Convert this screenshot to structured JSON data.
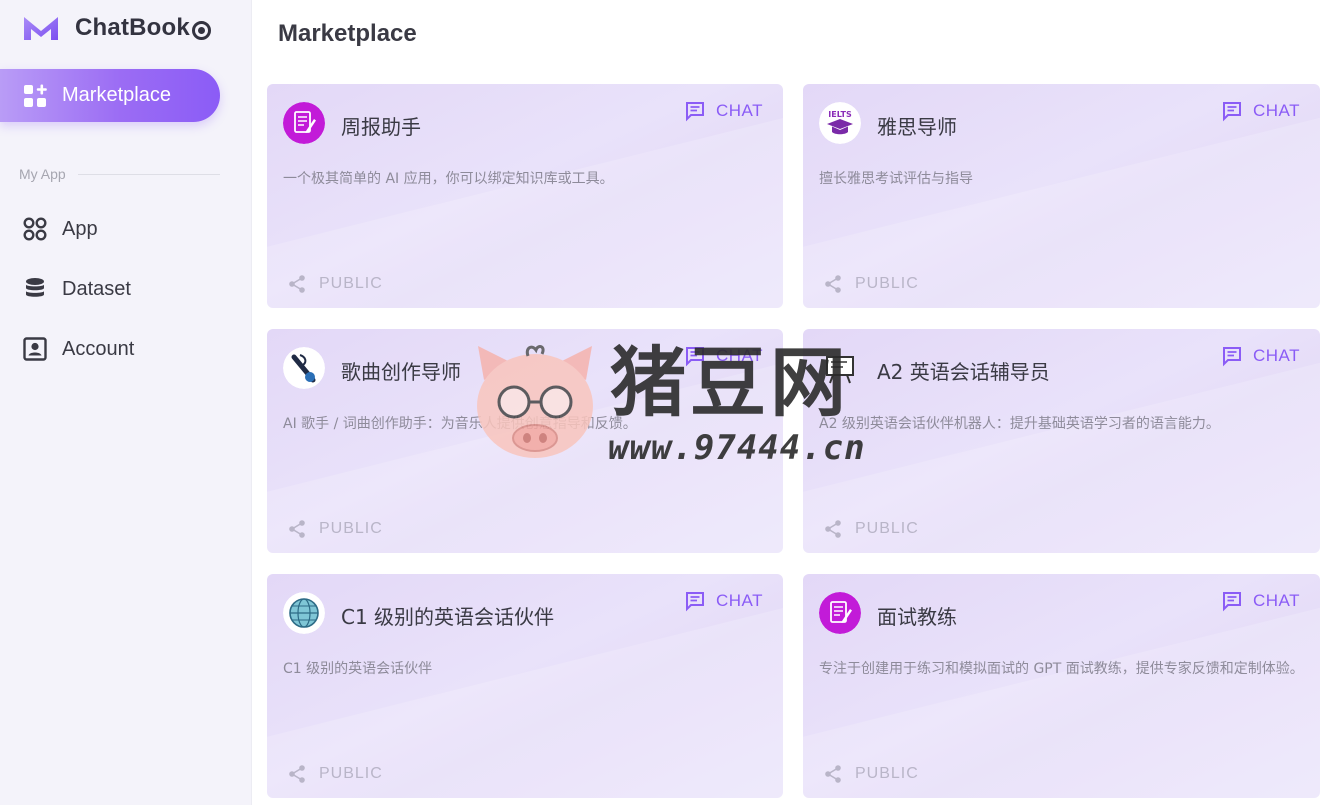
{
  "app": {
    "name": "ChatBook",
    "brand_color": "#8b5cf6"
  },
  "sidebar": {
    "active_item": {
      "label": "Marketplace",
      "icon": "grid-plus-icon"
    },
    "section_label": "My App",
    "items": [
      {
        "label": "App",
        "icon": "apps-icon"
      },
      {
        "label": "Dataset",
        "icon": "database-icon"
      },
      {
        "label": "Account",
        "icon": "account-box-icon"
      }
    ]
  },
  "main": {
    "title": "Marketplace",
    "chat_label": "CHAT",
    "public_label": "PUBLIC",
    "cards": [
      {
        "title": "周报助手",
        "description": "一个极其简单的 AI 应用，你可以绑定知识库或工具。",
        "avatar": "document-edit-icon"
      },
      {
        "title": "雅思导师",
        "description": "擅长雅思考试评估与指导",
        "avatar": "ielts-cap-icon"
      },
      {
        "title": "歌曲创作导师",
        "description": "AI 歌手 / 词曲创作助手：为音乐人提供创意指导和反馈。",
        "avatar": "music-note-icon"
      },
      {
        "title": "A2 英语会话辅导员",
        "description": "A2 级别英语会话伙伴机器人：提升基础英语学习者的语言能力。",
        "avatar": "board-icon"
      },
      {
        "title": "C1 级别的英语会话伙伴",
        "description": "C1 级别的英语会话伙伴",
        "avatar": "globe-icon"
      },
      {
        "title": "面试教练",
        "description": "专注于创建用于练习和模拟面试的 GPT 面试教练，提供专家反馈和定制体验。",
        "avatar": "document-edit-icon"
      }
    ]
  },
  "watermark": {
    "title": "猪豆网",
    "url": "www.97444.cn"
  }
}
